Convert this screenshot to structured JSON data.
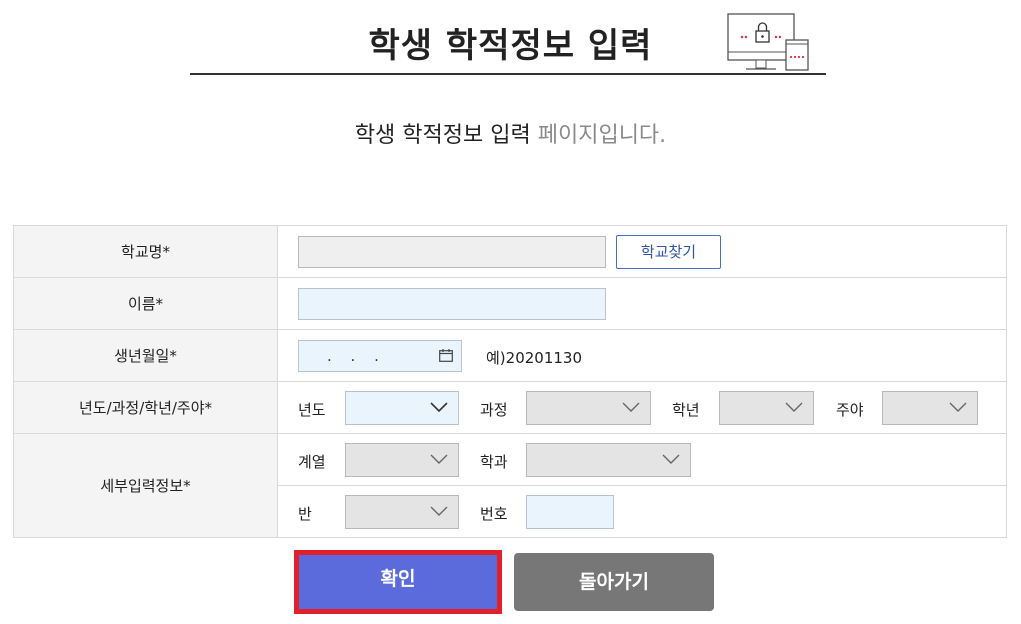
{
  "header": {
    "title": "학생 학적정보 입력"
  },
  "subtitle": {
    "strong": "학생 학적정보 입력",
    "muted": " 페이지입니다."
  },
  "form": {
    "school": {
      "label": "학교명*",
      "value": "",
      "search_button": "학교찾기"
    },
    "name": {
      "label": "이름*",
      "value": ""
    },
    "birth": {
      "label": "생년월일*",
      "value": ". . .",
      "example": "예)20201130"
    },
    "year_course": {
      "label": "년도/과정/학년/주야*",
      "year_label": "년도",
      "year_value": "",
      "course_label": "과정",
      "course_value": "",
      "grade_label": "학년",
      "grade_value": "",
      "shift_label": "주야",
      "shift_value": ""
    },
    "detail": {
      "label": "세부입력정보*",
      "track_label": "계열",
      "track_value": "",
      "dept_label": "학과",
      "dept_value": "",
      "class_label": "반",
      "class_value": "",
      "number_label": "번호",
      "number_value": ""
    }
  },
  "buttons": {
    "confirm": "확인",
    "back": "돌아가기"
  },
  "colors": {
    "confirm_bg": "#5b6bdc",
    "confirm_highlight": "#e0202a",
    "back_bg": "#777777",
    "accent": "#4472c4"
  }
}
